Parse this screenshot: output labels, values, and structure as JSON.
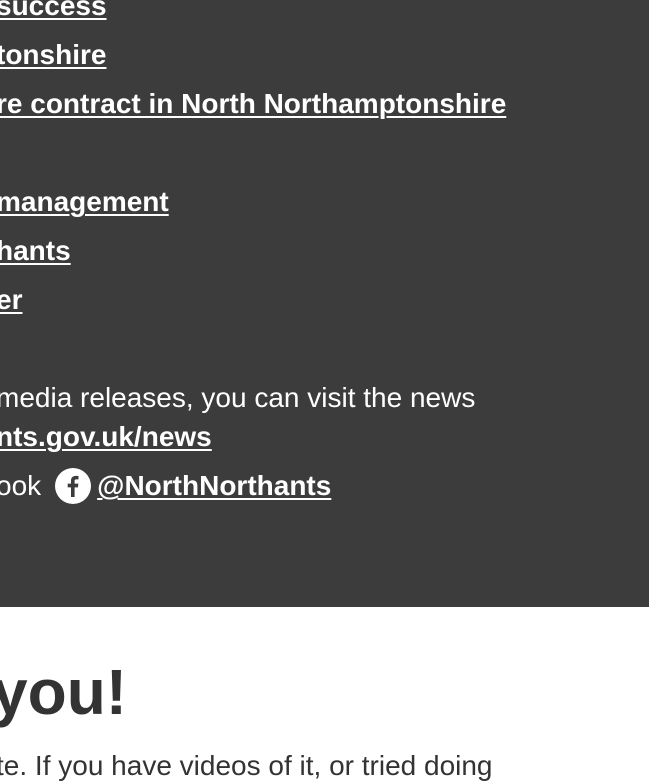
{
  "links_list": [
    {
      "label": "success"
    },
    {
      "label": "tonshire"
    },
    {
      "label": "re contract in North Northamptonshire"
    },
    {
      "label": "management"
    },
    {
      "label": "hants"
    },
    {
      "label": "er"
    }
  ],
  "news": {
    "text_before": "media releases, you can visit the news",
    "news_link": "nts.gov.uk/news"
  },
  "facebook": {
    "text_before": "ook",
    "icon": "facebook-icon",
    "handle": "@NorthNorthants"
  },
  "footer_section": {
    "heading": "you!",
    "paragraph": "te. If you have videos of it, or tried doing"
  },
  "colors": {
    "panel_bg": "#3c3c3c",
    "text_light": "#ffffff",
    "heading_color": "#333333",
    "page_bg": "#ffffff"
  }
}
